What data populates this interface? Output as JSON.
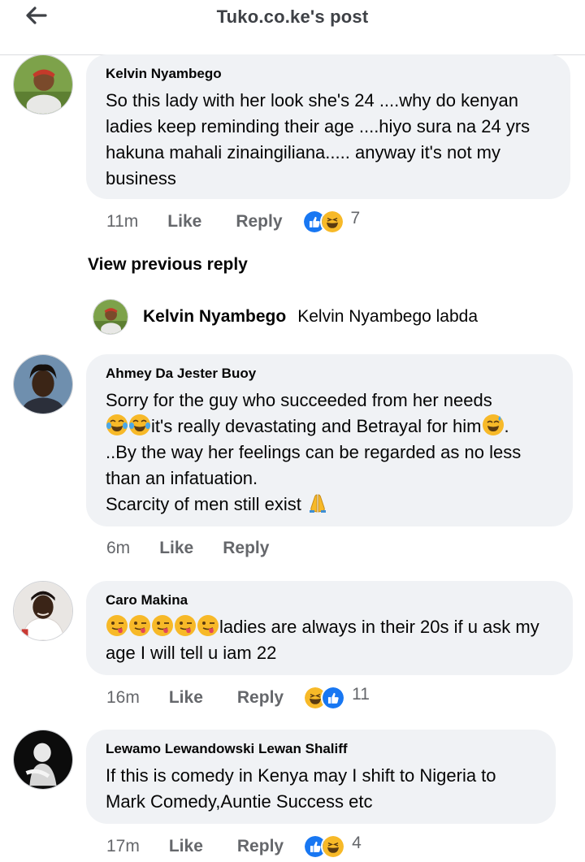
{
  "header": {
    "title": "Tuko.co.ke's post",
    "back_icon": "back-arrow-icon"
  },
  "comments": [
    {
      "author": "Kelvin Nyambego",
      "text": "So this lady with her look she's 24 ....why do kenyan ladies keep reminding their age ....hiyo sura na 24 yrs hakuna mahali zinaingiliana..... anyway it's not my business",
      "time": "11m",
      "like": "Like",
      "reply": "Reply",
      "reactions": [
        "like",
        "haha"
      ],
      "reaction_count": "7"
    },
    {
      "author": "Ahmey Da Jester Buoy",
      "text_lines": [
        "Sorry for the guy who succeeded from her needs",
        "it's really devastating and Betrayal for him",
        "..By the way her feelings can be regarded as no less than an infatuation.",
        "Scarcity of men still exist "
      ],
      "time": "6m",
      "like": "Like",
      "reply": "Reply"
    },
    {
      "author": "Caro Makina",
      "text": "ladies are always in their 20s if u ask my age I will tell u iam 22",
      "time": "16m",
      "like": "Like",
      "reply": "Reply",
      "reactions": [
        "haha",
        "like"
      ],
      "reaction_count": "11"
    },
    {
      "author": "Lewamo Lewandowski Lewan Shaliff",
      "text": "If this is comedy in Kenya may I shift to Nigeria to Mark Comedy,Auntie Success etc",
      "time": "17m",
      "like": "Like",
      "reply": "Reply",
      "reactions": [
        "like",
        "haha"
      ],
      "reaction_count": "4"
    }
  ],
  "view_previous": "View previous reply",
  "reply_preview": {
    "author": "Kelvin Nyambego",
    "text": "Kelvin Nyambego labda"
  },
  "colors": {
    "bubble": "#f0f2f5",
    "like_blue": "#1877f2",
    "haha_yellow": "#f7b928",
    "meta_gray": "#65676b"
  }
}
